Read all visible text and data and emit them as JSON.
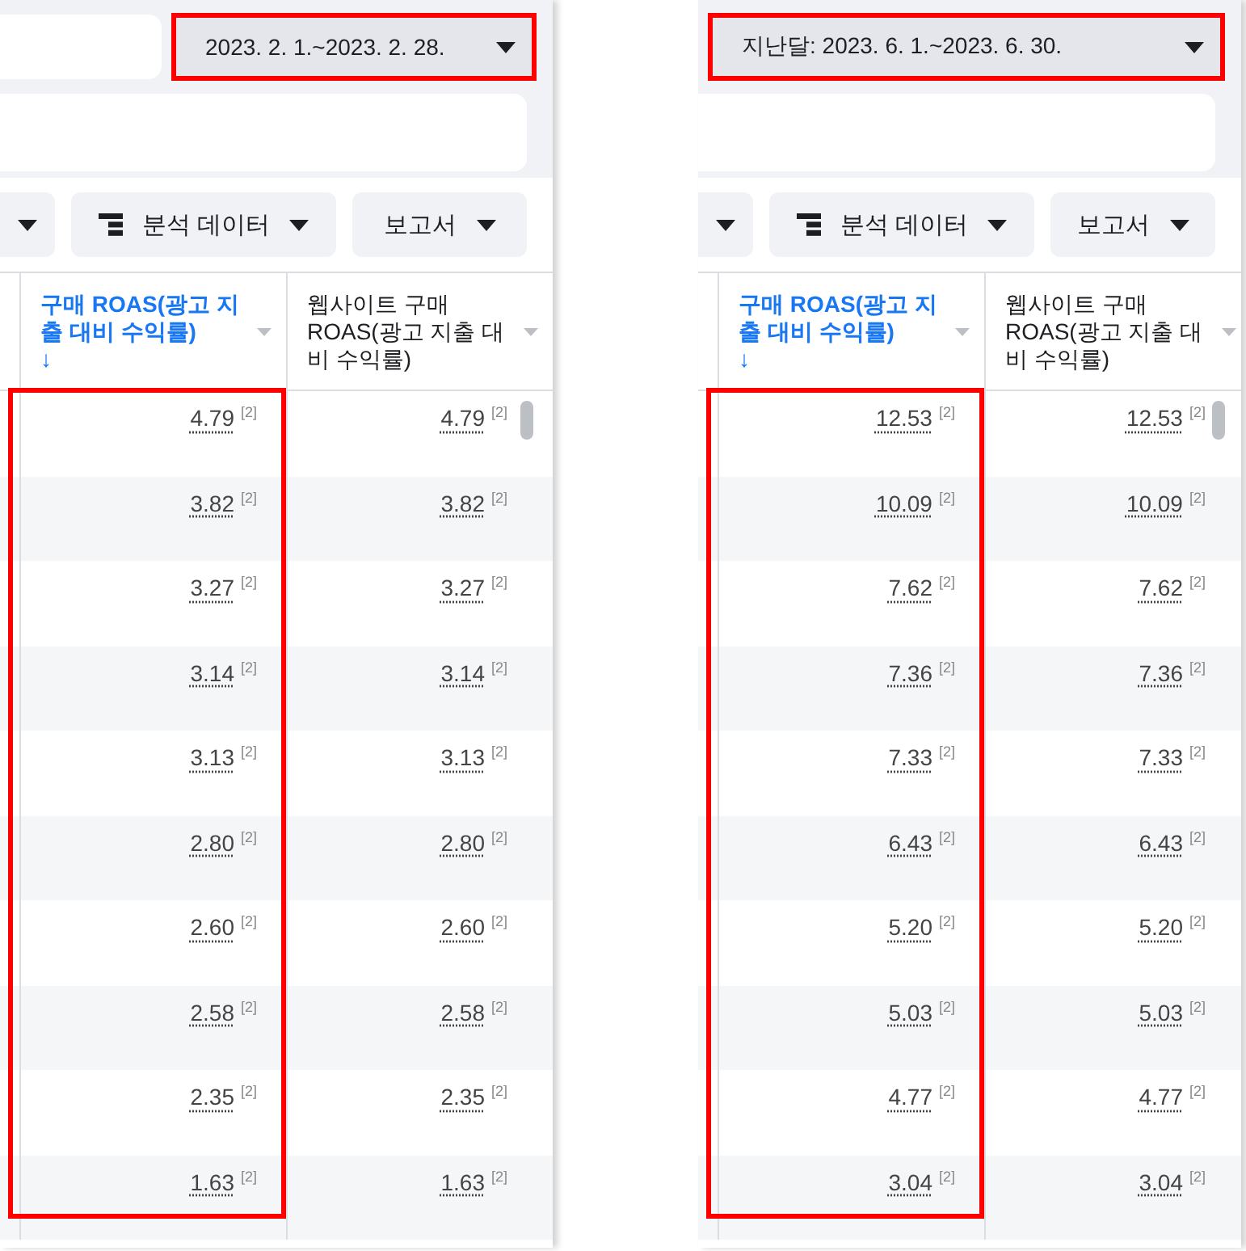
{
  "panels": [
    {
      "date_range": {
        "label": "2023. 2. 1.~2023. 2. 28.",
        "highlighted": true
      },
      "toolbar": {
        "breakdown_button": "분석 데이터",
        "reports_button": "보고서"
      },
      "columns": [
        {
          "title": "구매 ROAS(광고 지출 대비 수익률)",
          "sorted": true,
          "sort_arrow": "↓",
          "highlighted": true
        },
        {
          "title": "웹사이트 구매 ROAS(광고 지출 대비 수익률)",
          "sorted": false,
          "highlighted": false
        }
      ],
      "rows": [
        {
          "cells": [
            {
              "value": "4.79",
              "note": "[2]"
            },
            {
              "value": "4.79",
              "note": "[2]"
            }
          ]
        },
        {
          "cells": [
            {
              "value": "3.82",
              "note": "[2]"
            },
            {
              "value": "3.82",
              "note": "[2]"
            }
          ]
        },
        {
          "cells": [
            {
              "value": "3.27",
              "note": "[2]"
            },
            {
              "value": "3.27",
              "note": "[2]"
            }
          ]
        },
        {
          "cells": [
            {
              "value": "3.14",
              "note": "[2]"
            },
            {
              "value": "3.14",
              "note": "[2]"
            }
          ]
        },
        {
          "cells": [
            {
              "value": "3.13",
              "note": "[2]"
            },
            {
              "value": "3.13",
              "note": "[2]"
            }
          ]
        },
        {
          "cells": [
            {
              "value": "2.80",
              "note": "[2]"
            },
            {
              "value": "2.80",
              "note": "[2]"
            }
          ]
        },
        {
          "cells": [
            {
              "value": "2.60",
              "note": "[2]"
            },
            {
              "value": "2.60",
              "note": "[2]"
            }
          ]
        },
        {
          "cells": [
            {
              "value": "2.58",
              "note": "[2]"
            },
            {
              "value": "2.58",
              "note": "[2]"
            }
          ]
        },
        {
          "cells": [
            {
              "value": "2.35",
              "note": "[2]"
            },
            {
              "value": "2.35",
              "note": "[2]"
            }
          ]
        },
        {
          "cells": [
            {
              "value": "1.63",
              "note": "[2]"
            },
            {
              "value": "1.63",
              "note": "[2]"
            }
          ]
        }
      ]
    },
    {
      "date_range": {
        "label": "지난달: 2023. 6. 1.~2023. 6. 30.",
        "highlighted": true
      },
      "toolbar": {
        "breakdown_button": "분석 데이터",
        "reports_button": "보고서"
      },
      "columns": [
        {
          "title": "구매 ROAS(광고 지출 대비 수익률)",
          "sorted": true,
          "sort_arrow": "↓",
          "highlighted": true
        },
        {
          "title": "웹사이트 구매 ROAS(광고 지출 대비 수익률)",
          "sorted": false,
          "highlighted": false
        }
      ],
      "rows": [
        {
          "cells": [
            {
              "value": "12.53",
              "note": "[2]"
            },
            {
              "value": "12.53",
              "note": "[2]"
            }
          ]
        },
        {
          "cells": [
            {
              "value": "10.09",
              "note": "[2]"
            },
            {
              "value": "10.09",
              "note": "[2]"
            }
          ]
        },
        {
          "cells": [
            {
              "value": "7.62",
              "note": "[2]"
            },
            {
              "value": "7.62",
              "note": "[2]"
            }
          ]
        },
        {
          "cells": [
            {
              "value": "7.36",
              "note": "[2]"
            },
            {
              "value": "7.36",
              "note": "[2]"
            }
          ]
        },
        {
          "cells": [
            {
              "value": "7.33",
              "note": "[2]"
            },
            {
              "value": "7.33",
              "note": "[2]"
            }
          ]
        },
        {
          "cells": [
            {
              "value": "6.43",
              "note": "[2]"
            },
            {
              "value": "6.43",
              "note": "[2]"
            }
          ]
        },
        {
          "cells": [
            {
              "value": "5.20",
              "note": "[2]"
            },
            {
              "value": "5.20",
              "note": "[2]"
            }
          ]
        },
        {
          "cells": [
            {
              "value": "5.03",
              "note": "[2]"
            },
            {
              "value": "5.03",
              "note": "[2]"
            }
          ]
        },
        {
          "cells": [
            {
              "value": "4.77",
              "note": "[2]"
            },
            {
              "value": "4.77",
              "note": "[2]"
            }
          ]
        },
        {
          "cells": [
            {
              "value": "3.04",
              "note": "[2]"
            },
            {
              "value": "3.04",
              "note": "[2]"
            }
          ]
        }
      ]
    }
  ]
}
